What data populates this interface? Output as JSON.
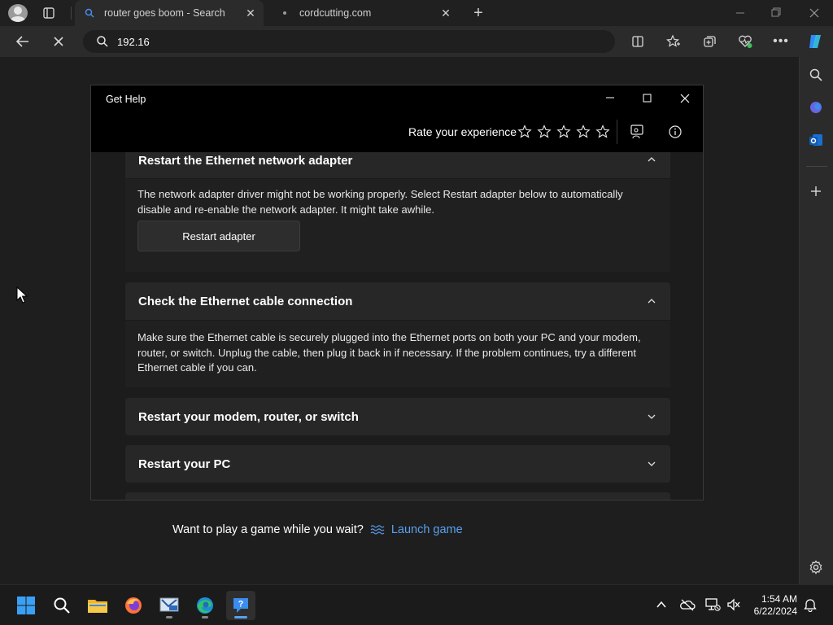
{
  "browser": {
    "tabs": [
      {
        "title": "router goes boom - Search",
        "active": true
      },
      {
        "title": "cordcutting.com",
        "active": false
      }
    ],
    "address": "192.16"
  },
  "gethelp": {
    "title": "Get Help",
    "rate_label": "Rate your experience",
    "sections": [
      {
        "heading": "Restart the Ethernet network adapter",
        "expanded": true,
        "text": "The network adapter driver might not be working properly. Select Restart adapter below to automatically disable and re-enable the network adapter. It might take awhile.",
        "button": "Restart adapter"
      },
      {
        "heading": "Check the Ethernet cable connection",
        "expanded": true,
        "text": "Make sure the Ethernet cable is securely plugged into the Ethernet ports on both your PC and your modem, router, or switch. Unplug the cable, then plug it back in if necessary. If the problem continues, try a different Ethernet cable if you can."
      },
      {
        "heading": "Restart your modem, router, or switch",
        "expanded": false
      },
      {
        "heading": "Restart your PC",
        "expanded": false
      }
    ]
  },
  "game": {
    "prompt": "Want to play a game while you wait?",
    "link": "Launch game"
  },
  "taskbar": {
    "time": "1:54 AM",
    "date": "6/22/2024"
  },
  "colors": {
    "accent": "#5aa0f0",
    "window_bg": "#202020",
    "card_bg": "#272727"
  }
}
